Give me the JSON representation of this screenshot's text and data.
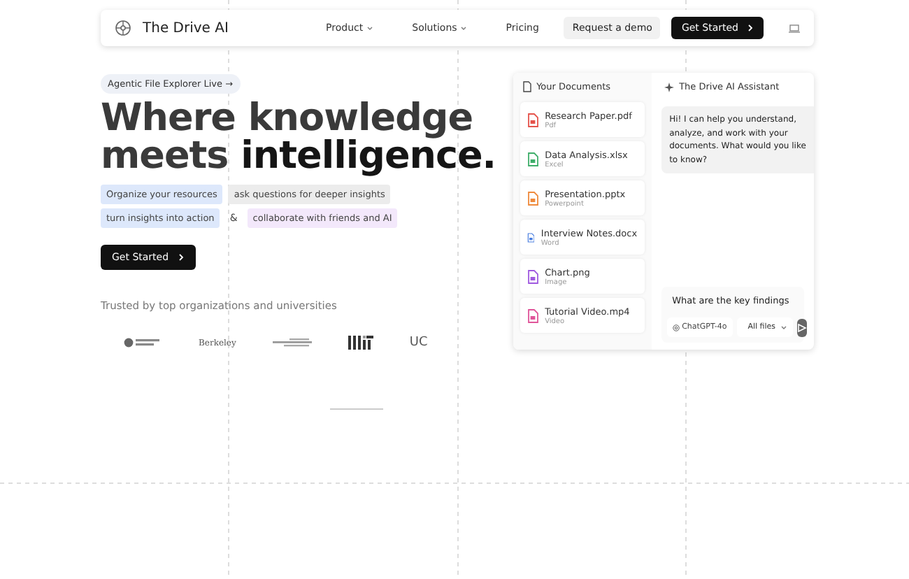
{
  "nav": {
    "brand": "The Drive AI",
    "links": [
      {
        "label": "Product",
        "dropdown": true
      },
      {
        "label": "Solutions",
        "dropdown": true
      },
      {
        "label": "Pricing",
        "dropdown": false
      }
    ],
    "demo": "Request a demo",
    "cta": "Get Started"
  },
  "hero": {
    "badge": "Agentic File Explorer Live →",
    "title_line1": "Where knowledge",
    "title_line2_light": "meets",
    "title_line2_bold": "intelligence.",
    "tags_row1": [
      {
        "label": "Organize your resources",
        "color": "#dde8fb"
      },
      {
        "label": "ask questions for deeper insights",
        "color": "#ececec"
      }
    ],
    "tags_row2": [
      {
        "label": "turn insights into action",
        "color": "#dde8fb"
      },
      {
        "label": "collaborate with friends and AI",
        "color": "#f3e8fb"
      }
    ],
    "ampersand": "&",
    "cta": "Get Started",
    "trusted": "Trusted by top organizations and universities",
    "logos": [
      {
        "kind": "crest"
      },
      {
        "kind": "word",
        "text": "Berkeley"
      },
      {
        "kind": "lines"
      },
      {
        "kind": "mit"
      },
      {
        "kind": "word",
        "text": "UC"
      }
    ]
  },
  "documents": {
    "title": "Your Documents",
    "items": [
      {
        "name": "Research Paper.pdf",
        "type": "Pdf",
        "color": "#e5534b"
      },
      {
        "name": "Data Analysis.xlsx",
        "type": "Excel",
        "color": "#3fae6a"
      },
      {
        "name": "Presentation.pptx",
        "type": "Powerpoint",
        "color": "#ef8a3c"
      },
      {
        "name": "Interview Notes.docx",
        "type": "Word",
        "color": "#4a7fe0"
      },
      {
        "name": "Chart.png",
        "type": "Image",
        "color": "#a05ae0"
      },
      {
        "name": "Tutorial Video.mp4",
        "type": "Video",
        "color": "#e0559a"
      }
    ]
  },
  "assistant": {
    "title": "The Drive AI Assistant",
    "message": "Hi! I can help you understand, analyze, and work with your documents. What would you like to know?",
    "input": "What are the key findings",
    "model": "ChatGPT-4o",
    "scope": "All files"
  }
}
